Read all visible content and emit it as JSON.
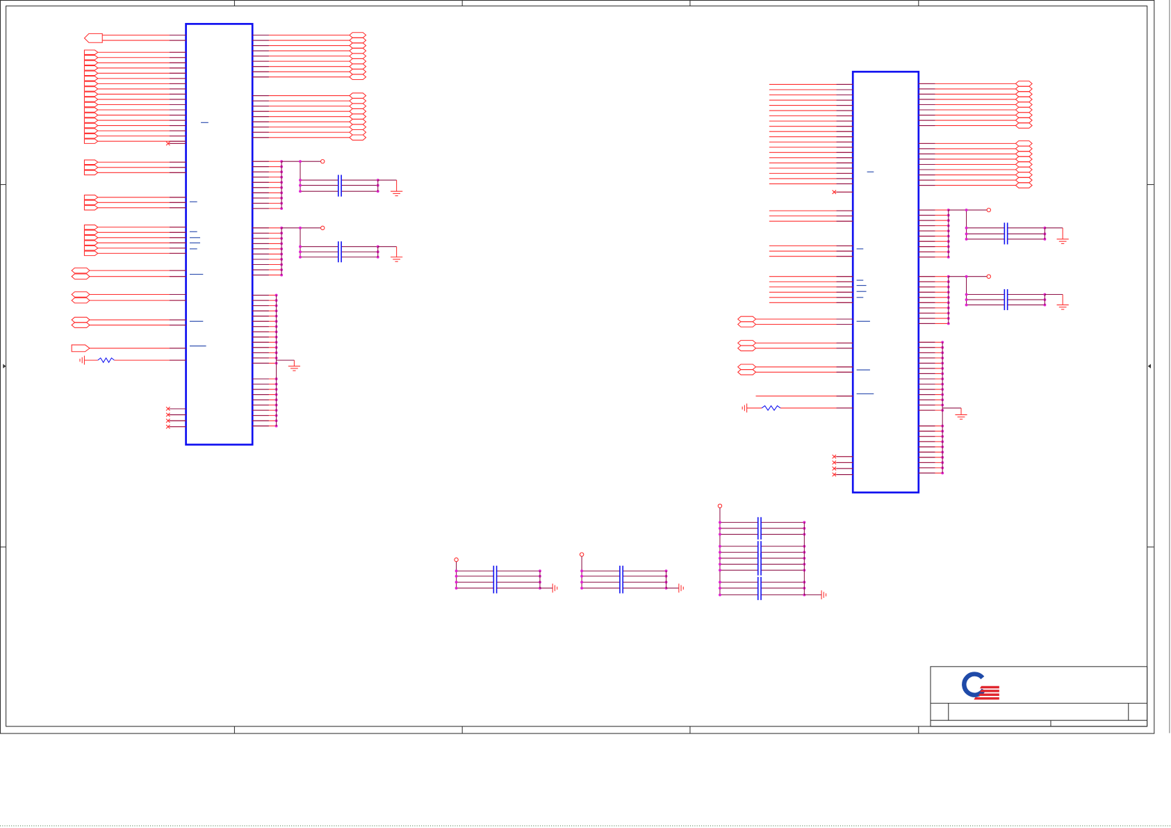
{
  "colors": {
    "frame": "#333333",
    "pin": "#ff2b2b",
    "wire": "#8c1046",
    "component": "#1010f0",
    "junction": "#e020d0",
    "overline": "#1a3ea8",
    "logo_blue": "#1f4aa8",
    "logo_red": "#e0262e",
    "scan_line": "#8aa98a"
  },
  "icons": {
    "logo": "company-logo-icon",
    "ground": "ground-icon",
    "power": "power-port-icon",
    "no_connect": "no-connect-icon"
  }
}
